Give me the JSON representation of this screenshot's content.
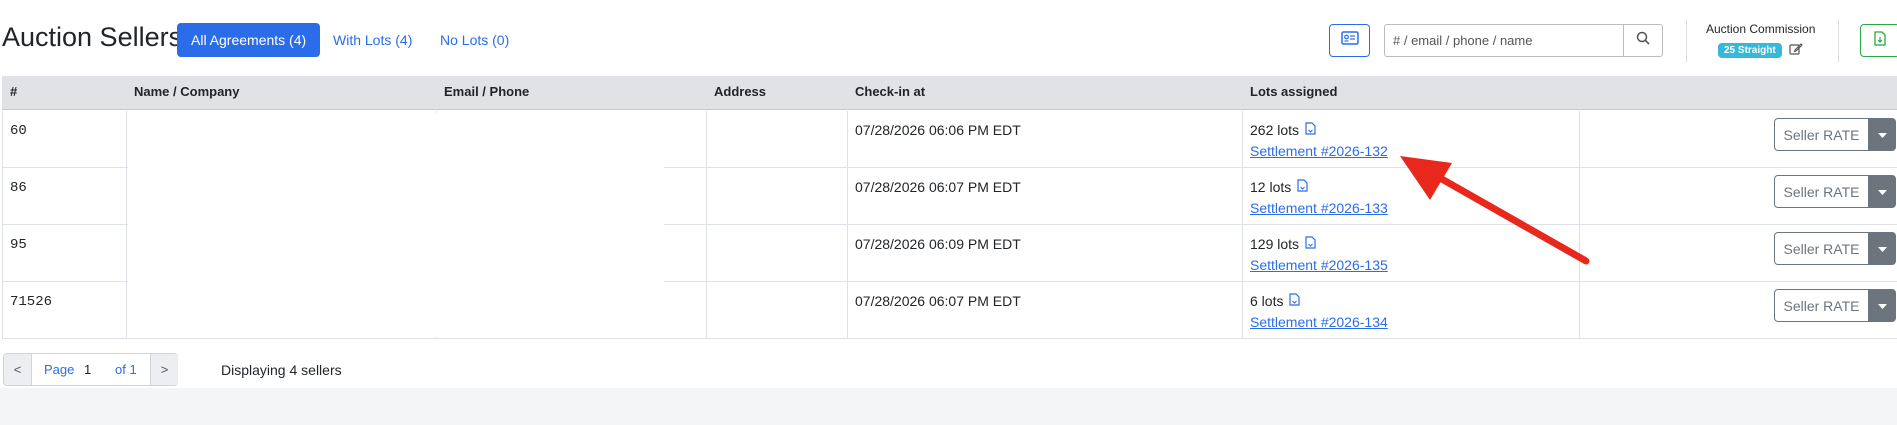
{
  "header": {
    "title": "Auction Sellers",
    "tabs": [
      {
        "label": "All Agreements (4)",
        "active": true
      },
      {
        "label": "With Lots (4)",
        "active": false
      },
      {
        "label": "No Lots (0)",
        "active": false
      }
    ],
    "search": {
      "placeholder": "# / email / phone / name",
      "value": ""
    },
    "commission": {
      "label": "Auction Commission",
      "badge": "25 Straight"
    }
  },
  "table": {
    "columns": [
      "#",
      "Name / Company",
      "Email / Phone",
      "Address",
      "Check-in at",
      "Lots assigned"
    ],
    "rows": [
      {
        "num": "60",
        "checkin": "07/28/2026 06:06 PM EDT",
        "lots": "262 lots",
        "settlement": "Settlement #2026-132",
        "action": "Seller RATE"
      },
      {
        "num": "86",
        "checkin": "07/28/2026 06:07 PM EDT",
        "lots": "12 lots",
        "settlement": "Settlement #2026-133",
        "action": "Seller RATE"
      },
      {
        "num": "95",
        "checkin": "07/28/2026 06:09 PM EDT",
        "lots": "129 lots",
        "settlement": "Settlement #2026-135",
        "action": "Seller RATE"
      },
      {
        "num": "71526",
        "checkin": "07/28/2026 06:07 PM EDT",
        "lots": "6 lots",
        "settlement": "Settlement #2026-134",
        "action": "Seller RATE"
      }
    ]
  },
  "pagination": {
    "prev": "<",
    "next": ">",
    "page_label": "Page",
    "page_value": "1",
    "of_label": "of 1",
    "summary": "Displaying 4 sellers"
  },
  "colors": {
    "accent": "#2b6de8",
    "badge": "#35b9d9",
    "export": "#28a745",
    "arrow": "#e8281c"
  },
  "icons": [
    "id-card-icon",
    "search-icon",
    "edit-icon",
    "export-file-icon",
    "file-icon",
    "caret-down-icon",
    "arrow-annotation"
  ]
}
